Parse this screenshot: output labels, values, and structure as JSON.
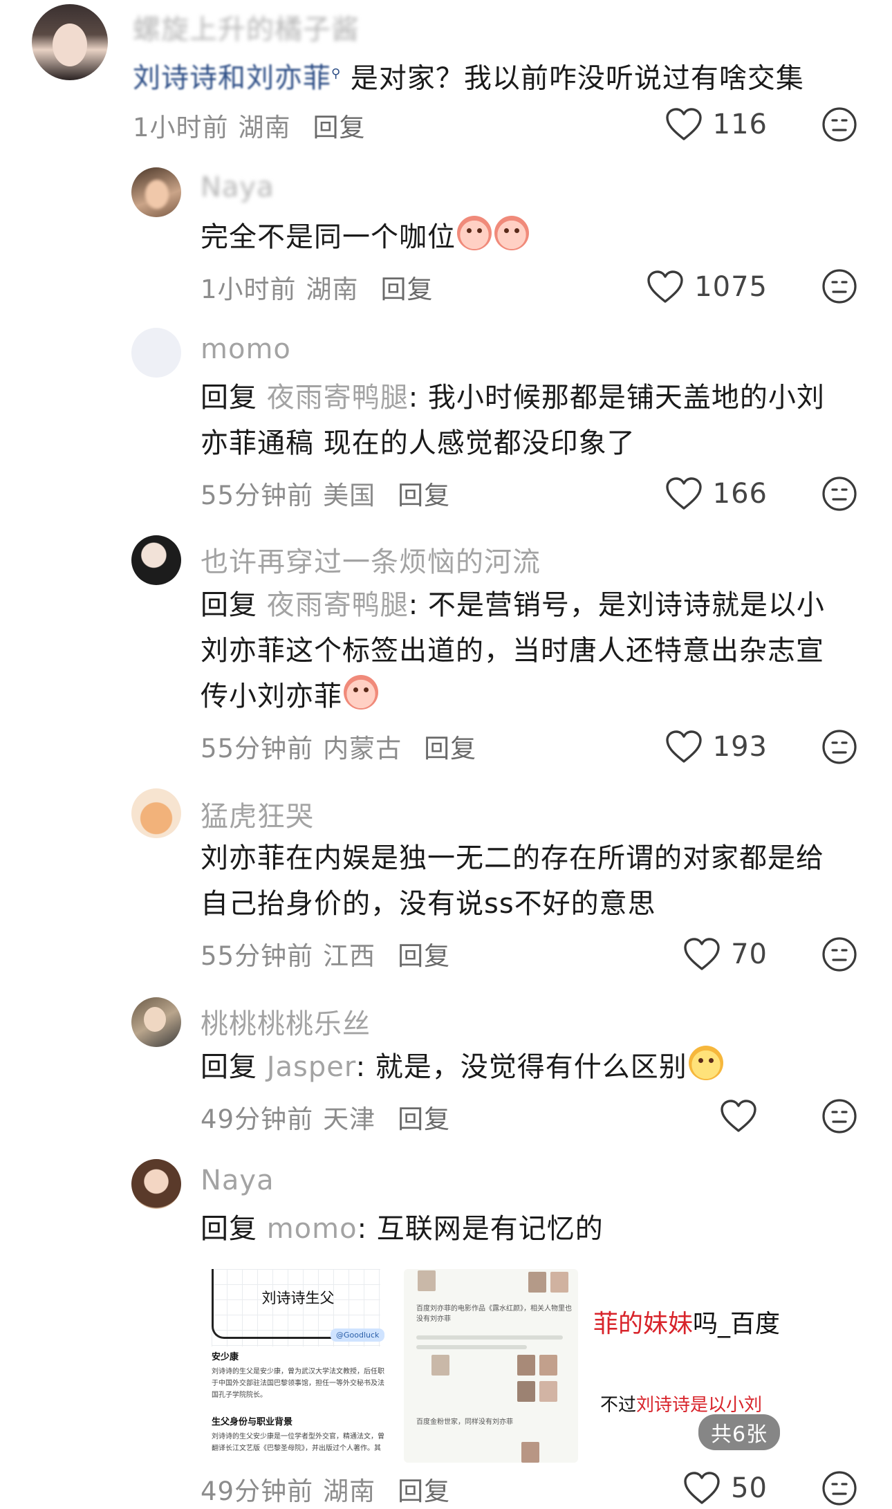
{
  "comments": [
    {
      "username": "螺旋上升的橘子酱",
      "body_mention": "刘诗诗和刘亦菲",
      "body_rest": "是对家？我以前咋没听说过有啥交集",
      "time": "1小时前",
      "location": "湖南",
      "reply_label": "回复",
      "likes": "116"
    },
    {
      "username": "Naya",
      "body": "完全不是同一个咖位",
      "time": "1小时前",
      "location": "湖南",
      "reply_label": "回复",
      "likes": "1075"
    },
    {
      "username": "momo",
      "reply_prefix": "回复",
      "reply_to": "夜雨寄鸭腿",
      "body_line1": ": 我小时候那都是铺天盖地的小刘",
      "body_line2": "亦菲通稿 现在的人感觉都没印象了",
      "time": "55分钟前",
      "location": "美国",
      "reply_label": "回复",
      "likes": "166"
    },
    {
      "username": "也许再穿过一条烦恼的河流",
      "reply_prefix": "回复",
      "reply_to": "夜雨寄鸭腿",
      "body_line1": ": 不是营销号，是刘诗诗就是以小",
      "body_line2": "刘亦菲这个标签出道的，当时唐人还特意出杂志宣",
      "body_line3": "传小刘亦菲",
      "time": "55分钟前",
      "location": "内蒙古",
      "reply_label": "回复",
      "likes": "193"
    },
    {
      "username": "猛虎狂哭",
      "body_line1": "刘亦菲在内娱是独一无二的存在所谓的对家都是给",
      "body_line2": "自己抬身价的，没有说ss不好的意思",
      "time": "55分钟前",
      "location": "江西",
      "reply_label": "回复",
      "likes": "70"
    },
    {
      "username": "桃桃桃桃乐丝",
      "reply_prefix": "回复",
      "reply_to": "Jasper",
      "body_line1": ": 就是，没觉得有什么区别",
      "time": "49分钟前",
      "location": "天津",
      "reply_label": "回复",
      "likes": ""
    },
    {
      "username": "Naya",
      "reply_prefix": "回复",
      "reply_to": "momo",
      "body_line1": ": 互联网是有记忆的",
      "time": "49分钟前",
      "location": "湖南",
      "reply_label": "回复",
      "likes": "50"
    }
  ],
  "thumbnails": {
    "thumb1_title": "刘诗诗生父",
    "thumb1_badge": "@Goodluck",
    "thumb1_heading1": "安少康",
    "thumb1_para1": "刘诗诗的生父是安少康，曾为武汉大学法文教授，后任职于中国外交部驻法国巴黎领事馆，担任一等外交秘书及法国孔子学院院长。",
    "thumb1_heading2": "生父身份与职业背景",
    "thumb1_para2": "刘诗诗的生父安少康是一位学者型外交官，精通法文，曾翻译长江文艺版《巴黎圣母院》，并出版过个人著作。其",
    "thumb2_caption1": "百度刘亦菲的电影作品《露水红颜》，相关人物里也没有刘亦菲",
    "thumb2_caption2": "百度金粉世家，同样没有刘亦菲",
    "thumb3_line1_red": "菲的妹妹",
    "thumb3_line1_rest": "吗_百度",
    "thumb3_line2_pre": "不过",
    "thumb3_line2_red": "刘诗诗是",
    "thumb3_line2_post": "以小刘",
    "image_count": "共6张"
  },
  "colors": {
    "username": "#a3a3a3",
    "mention_link": "#2d4e86",
    "red_highlight": "#d8232a"
  }
}
